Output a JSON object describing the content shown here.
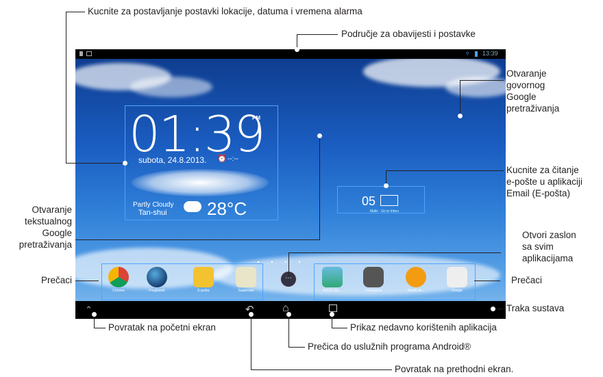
{
  "annotations": {
    "alarm": "Kucnite za postavljanje postavki lokacije, datuma i vremena alarma",
    "notif": "Područje za obavijesti i postavke",
    "voice_l1": "Otvaranje",
    "voice_l2": "govornog",
    "voice_l3": "Google",
    "voice_l4": "pretraživanja",
    "email_l1": "Kucnite za čitanje",
    "email_l2": "e-pošte u aplikaciji",
    "email_l3": "Email (E-pošta)",
    "text_l1": "Otvaranje",
    "text_l2": "tekstualnog",
    "text_l3": "Google",
    "text_l4": "pretraživanja",
    "allapps_l1": "Otvori zaslon",
    "allapps_l2": "sa svim",
    "allapps_l3": "aplikacijama",
    "shortcuts_left": "Prečaci",
    "shortcuts_right": "Prečaci",
    "systembar": "Traka sustava",
    "home": "Povratak na početni ekran",
    "recent": "Prikaz nedavno korištenih aplikacija",
    "android": "Prečica do uslužnih programa Android®",
    "back": "Povratak na prethodni ekran."
  },
  "screen": {
    "status_time": "13:39",
    "clock_time": "01:39",
    "clock_ampm": "PM",
    "clock_date": "subota, 24.8.2013.",
    "alarm_text": "--:--",
    "weather_condition": "Partly Cloudy",
    "weather_city": "Tan-shui",
    "weather_temp": "28°C",
    "mail_count": "05",
    "mail_label": "Mails · Go to Inbox",
    "left_apps": [
      "Chrome",
      "Preglednik",
      "E-pošta",
      "Supernote"
    ],
    "right_apps": [
      "ASUS Stu...",
      "Fotoaparat",
      "Studio ak...",
      "Google"
    ]
  }
}
